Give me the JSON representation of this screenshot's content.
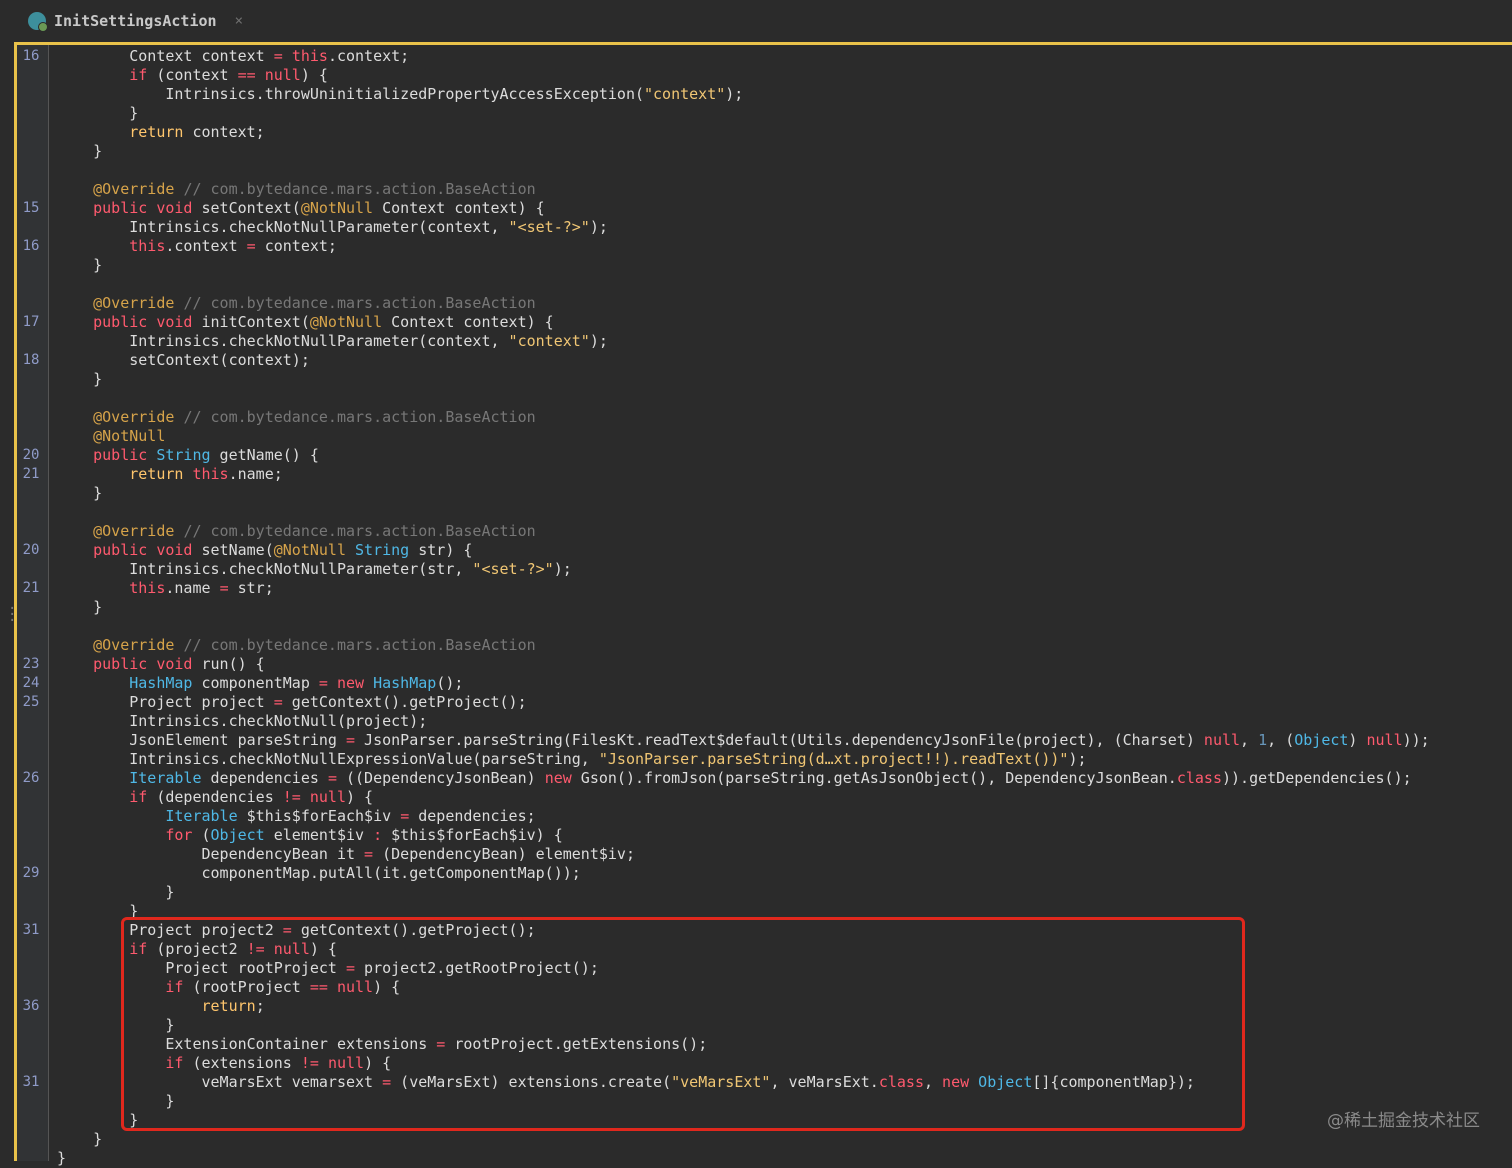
{
  "tab": {
    "title": "InitSettingsAction",
    "close_glyph": "×",
    "icon": "kotlin-class-icon"
  },
  "colors": {
    "background": "#2b2b2b",
    "accent_border": "#e9c24a",
    "highlight_box": "#e0281d",
    "keyword": "#ffc66d",
    "keyword_red": "#ff5a6e",
    "type": "#4fb8e6",
    "string": "#f0c674",
    "comment": "#777777"
  },
  "code_lines": [
    {
      "ln": "16",
      "tokens": [
        [
          "",
          "        Context context "
        ],
        [
          "op",
          "="
        ],
        [
          "",
          " "
        ],
        [
          "kw2",
          "this"
        ],
        [
          "",
          ".context;"
        ]
      ]
    },
    {
      "ln": "",
      "tokens": [
        [
          "",
          "        "
        ],
        [
          "kw2",
          "if"
        ],
        [
          "",
          " (context "
        ],
        [
          "op",
          "=="
        ],
        [
          "",
          " "
        ],
        [
          "kw2",
          "null"
        ],
        [
          "",
          ") {"
        ]
      ]
    },
    {
      "ln": "",
      "tokens": [
        [
          "",
          "            Intrinsics.throwUninitializedPropertyAccessException("
        ],
        [
          "str",
          "\"context\""
        ],
        [
          "",
          ");"
        ]
      ]
    },
    {
      "ln": "",
      "tokens": [
        [
          "",
          "        }"
        ]
      ]
    },
    {
      "ln": "",
      "tokens": [
        [
          "",
          "        "
        ],
        [
          "kw",
          "return"
        ],
        [
          "",
          " context;"
        ]
      ]
    },
    {
      "ln": "",
      "tokens": [
        [
          "",
          "    }"
        ]
      ]
    },
    {
      "ln": "",
      "tokens": [
        [
          "",
          ""
        ]
      ]
    },
    {
      "ln": "",
      "tokens": [
        [
          "",
          "    "
        ],
        [
          "an",
          "@Override"
        ],
        [
          "",
          " "
        ],
        [
          "cm",
          "// com.bytedance.mars.action.BaseAction"
        ]
      ]
    },
    {
      "ln": "15",
      "tokens": [
        [
          "",
          "    "
        ],
        [
          "kw2",
          "public"
        ],
        [
          "",
          " "
        ],
        [
          "kw2",
          "void"
        ],
        [
          "",
          " setContext("
        ],
        [
          "an",
          "@NotNull"
        ],
        [
          "",
          " Context context) {"
        ]
      ]
    },
    {
      "ln": "",
      "tokens": [
        [
          "",
          "        Intrinsics.checkNotNullParameter(context, "
        ],
        [
          "str",
          "\"<set-?>\""
        ],
        [
          "",
          ");"
        ]
      ]
    },
    {
      "ln": "16",
      "tokens": [
        [
          "",
          "        "
        ],
        [
          "kw2",
          "this"
        ],
        [
          "",
          ".context "
        ],
        [
          "op",
          "="
        ],
        [
          "",
          " context;"
        ]
      ]
    },
    {
      "ln": "",
      "tokens": [
        [
          "",
          "    }"
        ]
      ]
    },
    {
      "ln": "",
      "tokens": [
        [
          "",
          ""
        ]
      ]
    },
    {
      "ln": "",
      "tokens": [
        [
          "",
          "    "
        ],
        [
          "an",
          "@Override"
        ],
        [
          "",
          " "
        ],
        [
          "cm",
          "// com.bytedance.mars.action.BaseAction"
        ]
      ]
    },
    {
      "ln": "17",
      "tokens": [
        [
          "",
          "    "
        ],
        [
          "kw2",
          "public"
        ],
        [
          "",
          " "
        ],
        [
          "kw2",
          "void"
        ],
        [
          "",
          " initContext("
        ],
        [
          "an",
          "@NotNull"
        ],
        [
          "",
          " Context context) {"
        ]
      ]
    },
    {
      "ln": "",
      "tokens": [
        [
          "",
          "        Intrinsics.checkNotNullParameter(context, "
        ],
        [
          "str",
          "\"context\""
        ],
        [
          "",
          ");"
        ]
      ]
    },
    {
      "ln": "18",
      "tokens": [
        [
          "",
          "        setContext(context);"
        ]
      ]
    },
    {
      "ln": "",
      "tokens": [
        [
          "",
          "    }"
        ]
      ]
    },
    {
      "ln": "",
      "tokens": [
        [
          "",
          ""
        ]
      ]
    },
    {
      "ln": "",
      "tokens": [
        [
          "",
          "    "
        ],
        [
          "an",
          "@Override"
        ],
        [
          "",
          " "
        ],
        [
          "cm",
          "// com.bytedance.mars.action.BaseAction"
        ]
      ]
    },
    {
      "ln": "",
      "tokens": [
        [
          "",
          "    "
        ],
        [
          "an",
          "@NotNull"
        ]
      ]
    },
    {
      "ln": "20",
      "tokens": [
        [
          "",
          "    "
        ],
        [
          "kw2",
          "public"
        ],
        [
          "",
          " "
        ],
        [
          "tp",
          "String"
        ],
        [
          "",
          " getName() {"
        ]
      ]
    },
    {
      "ln": "21",
      "tokens": [
        [
          "",
          "        "
        ],
        [
          "kw",
          "return"
        ],
        [
          "",
          " "
        ],
        [
          "kw2",
          "this"
        ],
        [
          "",
          ".name;"
        ]
      ]
    },
    {
      "ln": "",
      "tokens": [
        [
          "",
          "    }"
        ]
      ]
    },
    {
      "ln": "",
      "tokens": [
        [
          "",
          ""
        ]
      ]
    },
    {
      "ln": "",
      "tokens": [
        [
          "",
          "    "
        ],
        [
          "an",
          "@Override"
        ],
        [
          "",
          " "
        ],
        [
          "cm",
          "// com.bytedance.mars.action.BaseAction"
        ]
      ]
    },
    {
      "ln": "20",
      "tokens": [
        [
          "",
          "    "
        ],
        [
          "kw2",
          "public"
        ],
        [
          "",
          " "
        ],
        [
          "kw2",
          "void"
        ],
        [
          "",
          " setName("
        ],
        [
          "an",
          "@NotNull"
        ],
        [
          "",
          " "
        ],
        [
          "tp",
          "String"
        ],
        [
          "",
          " str) {"
        ]
      ]
    },
    {
      "ln": "",
      "tokens": [
        [
          "",
          "        Intrinsics.checkNotNullParameter(str, "
        ],
        [
          "str",
          "\"<set-?>\""
        ],
        [
          "",
          ");"
        ]
      ]
    },
    {
      "ln": "21",
      "tokens": [
        [
          "",
          "        "
        ],
        [
          "kw2",
          "this"
        ],
        [
          "",
          ".name "
        ],
        [
          "op",
          "="
        ],
        [
          "",
          " str;"
        ]
      ]
    },
    {
      "ln": "",
      "tokens": [
        [
          "",
          "    }"
        ]
      ]
    },
    {
      "ln": "",
      "tokens": [
        [
          "",
          ""
        ]
      ]
    },
    {
      "ln": "",
      "tokens": [
        [
          "",
          "    "
        ],
        [
          "an",
          "@Override"
        ],
        [
          "",
          " "
        ],
        [
          "cm",
          "// com.bytedance.mars.action.BaseAction"
        ]
      ]
    },
    {
      "ln": "23",
      "tokens": [
        [
          "",
          "    "
        ],
        [
          "kw2",
          "public"
        ],
        [
          "",
          " "
        ],
        [
          "kw2",
          "void"
        ],
        [
          "",
          " run() {"
        ]
      ]
    },
    {
      "ln": "24",
      "tokens": [
        [
          "",
          "        "
        ],
        [
          "tp",
          "HashMap"
        ],
        [
          "",
          " componentMap "
        ],
        [
          "op",
          "="
        ],
        [
          "",
          " "
        ],
        [
          "kw2",
          "new"
        ],
        [
          "",
          " "
        ],
        [
          "tp",
          "HashMap"
        ],
        [
          "",
          "();"
        ]
      ]
    },
    {
      "ln": "25",
      "tokens": [
        [
          "",
          "        Project project "
        ],
        [
          "op",
          "="
        ],
        [
          "",
          " getContext().getProject();"
        ]
      ]
    },
    {
      "ln": "",
      "tokens": [
        [
          "",
          "        Intrinsics.checkNotNull(project);"
        ]
      ]
    },
    {
      "ln": "",
      "tokens": [
        [
          "",
          "        JsonElement parseString "
        ],
        [
          "op",
          "="
        ],
        [
          "",
          " JsonParser.parseString(FilesKt.readText$default(Utils.dependencyJsonFile(project), (Charset) "
        ],
        [
          "kw2",
          "null"
        ],
        [
          "",
          ", "
        ],
        [
          "num",
          "1"
        ],
        [
          "",
          ", ("
        ],
        [
          "tp",
          "Object"
        ],
        [
          "",
          ") "
        ],
        [
          "kw2",
          "null"
        ],
        [
          "",
          "));"
        ]
      ]
    },
    {
      "ln": "",
      "tokens": [
        [
          "",
          "        Intrinsics.checkNotNullExpressionValue(parseString, "
        ],
        [
          "str",
          "\"JsonParser.parseString(d…xt.project!!).readText())\""
        ],
        [
          "",
          ");"
        ]
      ]
    },
    {
      "ln": "26",
      "tokens": [
        [
          "",
          "        "
        ],
        [
          "tp",
          "Iterable"
        ],
        [
          "",
          " dependencies "
        ],
        [
          "op",
          "="
        ],
        [
          "",
          " ((DependencyJsonBean) "
        ],
        [
          "kw2",
          "new"
        ],
        [
          "",
          " Gson().fromJson(parseString.getAsJsonObject(), DependencyJsonBean."
        ],
        [
          "kw2",
          "class"
        ],
        [
          "",
          ")).getDependencies();"
        ]
      ]
    },
    {
      "ln": "",
      "tokens": [
        [
          "",
          "        "
        ],
        [
          "kw2",
          "if"
        ],
        [
          "",
          " (dependencies "
        ],
        [
          "op",
          "!="
        ],
        [
          "",
          " "
        ],
        [
          "kw2",
          "null"
        ],
        [
          "",
          ") {"
        ]
      ]
    },
    {
      "ln": "",
      "tokens": [
        [
          "",
          "            "
        ],
        [
          "tp",
          "Iterable"
        ],
        [
          "",
          " $this$forEach$iv "
        ],
        [
          "op",
          "="
        ],
        [
          "",
          " dependencies;"
        ]
      ]
    },
    {
      "ln": "",
      "tokens": [
        [
          "",
          "            "
        ],
        [
          "kw2",
          "for"
        ],
        [
          "",
          " ("
        ],
        [
          "tp",
          "Object"
        ],
        [
          "",
          " element$iv "
        ],
        [
          "op",
          ":"
        ],
        [
          "",
          " $this$forEach$iv) {"
        ]
      ]
    },
    {
      "ln": "",
      "tokens": [
        [
          "",
          "                DependencyBean it "
        ],
        [
          "op",
          "="
        ],
        [
          "",
          " (DependencyBean) element$iv;"
        ]
      ]
    },
    {
      "ln": "29",
      "tokens": [
        [
          "",
          "                componentMap.putAll(it.getComponentMap());"
        ]
      ]
    },
    {
      "ln": "",
      "tokens": [
        [
          "",
          "            }"
        ]
      ]
    },
    {
      "ln": "",
      "tokens": [
        [
          "",
          "        }"
        ]
      ]
    },
    {
      "ln": "31",
      "tokens": [
        [
          "",
          "        Project project2 "
        ],
        [
          "op",
          "="
        ],
        [
          "",
          " getContext().getProject();"
        ]
      ]
    },
    {
      "ln": "",
      "tokens": [
        [
          "",
          "        "
        ],
        [
          "kw2",
          "if"
        ],
        [
          "",
          " (project2 "
        ],
        [
          "op",
          "!="
        ],
        [
          "",
          " "
        ],
        [
          "kw2",
          "null"
        ],
        [
          "",
          ") {"
        ]
      ]
    },
    {
      "ln": "",
      "tokens": [
        [
          "",
          "            Project rootProject "
        ],
        [
          "op",
          "="
        ],
        [
          "",
          " project2.getRootProject();"
        ]
      ]
    },
    {
      "ln": "",
      "tokens": [
        [
          "",
          "            "
        ],
        [
          "kw2",
          "if"
        ],
        [
          "",
          " (rootProject "
        ],
        [
          "op",
          "=="
        ],
        [
          "",
          " "
        ],
        [
          "kw2",
          "null"
        ],
        [
          "",
          ") {"
        ]
      ]
    },
    {
      "ln": "36",
      "tokens": [
        [
          "",
          "                "
        ],
        [
          "kw",
          "return"
        ],
        [
          "",
          ";"
        ]
      ]
    },
    {
      "ln": "",
      "tokens": [
        [
          "",
          "            }"
        ]
      ]
    },
    {
      "ln": "",
      "tokens": [
        [
          "",
          "            ExtensionContainer extensions "
        ],
        [
          "op",
          "="
        ],
        [
          "",
          " rootProject.getExtensions();"
        ]
      ]
    },
    {
      "ln": "",
      "tokens": [
        [
          "",
          "            "
        ],
        [
          "kw2",
          "if"
        ],
        [
          "",
          " (extensions "
        ],
        [
          "op",
          "!="
        ],
        [
          "",
          " "
        ],
        [
          "kw2",
          "null"
        ],
        [
          "",
          ") {"
        ]
      ]
    },
    {
      "ln": "31",
      "tokens": [
        [
          "",
          "                veMarsExt vemarsext "
        ],
        [
          "op",
          "="
        ],
        [
          "",
          " (veMarsExt) extensions.create("
        ],
        [
          "str",
          "\"veMarsExt\""
        ],
        [
          "",
          ", veMarsExt."
        ],
        [
          "kw2",
          "class"
        ],
        [
          "",
          ", "
        ],
        [
          "kw2",
          "new"
        ],
        [
          "",
          " "
        ],
        [
          "tp",
          "Object"
        ],
        [
          "",
          "[]{componentMap});"
        ]
      ]
    },
    {
      "ln": "",
      "tokens": [
        [
          "",
          "            }"
        ]
      ]
    },
    {
      "ln": "",
      "tokens": [
        [
          "",
          "        }"
        ]
      ]
    },
    {
      "ln": "",
      "tokens": [
        [
          "",
          "    }"
        ]
      ]
    },
    {
      "ln": "",
      "tokens": [
        [
          "",
          "}"
        ]
      ]
    }
  ],
  "watermark": "@稀土掘金技术社区"
}
